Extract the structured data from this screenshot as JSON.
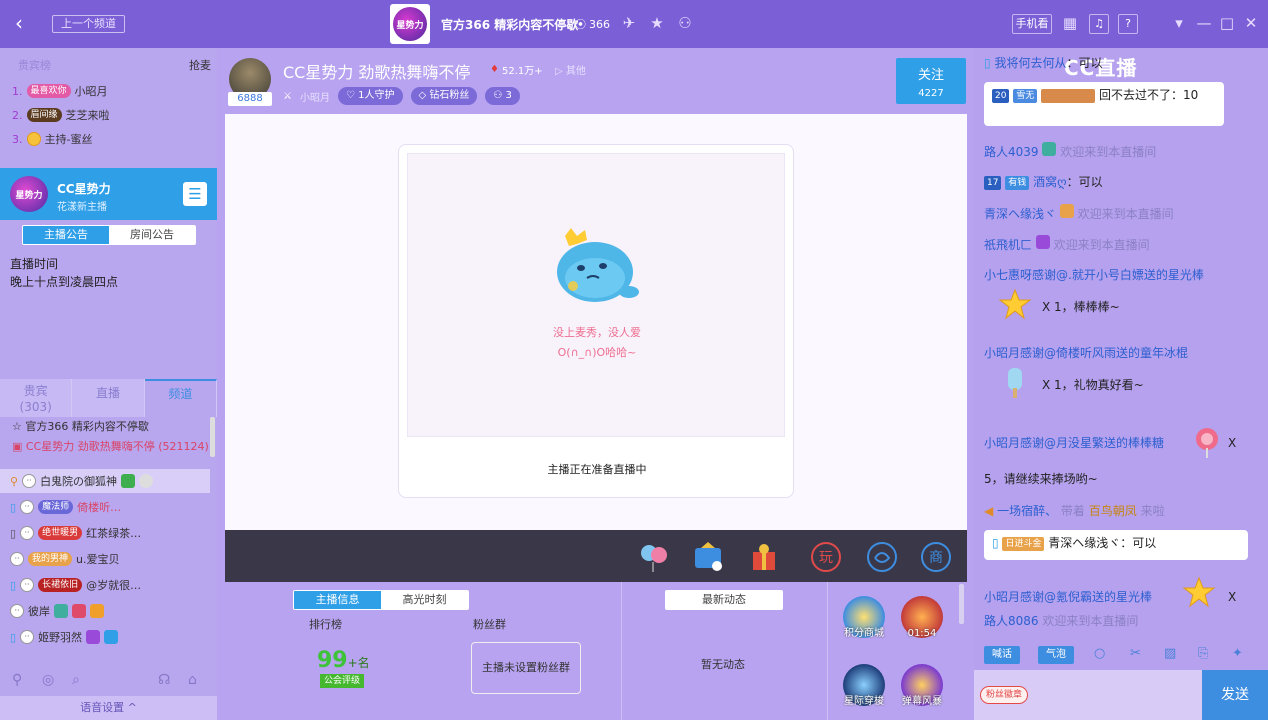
{
  "titlebar": {
    "prev_channel": "上一个频道",
    "channel_title": "官方366 精彩内容不停歇",
    "online_count": "366",
    "phone_watch": "手机看",
    "logo_text": "星势力"
  },
  "left": {
    "rank_header_left": "贵宾榜",
    "rank_header_right": "抢麦",
    "rank": [
      {
        "num": "1.",
        "medal": "最喜欢你",
        "name": "小昭月"
      },
      {
        "num": "2.",
        "medal": "眉间缘",
        "name": "芝芝来啦"
      },
      {
        "num": "3.",
        "medal": "",
        "name": "主持-蜜丝"
      }
    ],
    "anchor": {
      "name": "CC星势力",
      "subtitle": "花漾新主播",
      "avatar_text": "星势力"
    },
    "announce_tabs": [
      "主播公告",
      "房间公告"
    ],
    "announce_text": [
      "直播时间",
      "晚上十点到凌晨四点"
    ],
    "audience_tabs": [
      {
        "label": "贵宾",
        "count": "(303)"
      },
      {
        "label": "直播"
      },
      {
        "label": "频道"
      }
    ],
    "channels": [
      {
        "label": "官方366  精彩内容不停歇"
      },
      {
        "label": "CC星势力  劲歌热舞嗨不停",
        "extra": "(521124)"
      }
    ],
    "audience": [
      {
        "name": "白鬼院の御狐神"
      },
      {
        "name": "魔法师",
        "extra": "倚楼听…"
      },
      {
        "name": "绝世暖男",
        "extra": "红茶绿茶…"
      },
      {
        "name": "我的男神",
        "extra": "u.爱宝贝"
      },
      {
        "name": "长裙依旧",
        "extra": "@岁就很…"
      },
      {
        "name": "彼岸"
      },
      {
        "name": "姬野羽然"
      }
    ],
    "voice_settings": "语音设置 ^"
  },
  "stream": {
    "title": "CC星势力 劲歌热舞嗨不停",
    "heat": "52.1万+",
    "other": "其他",
    "room_id": "6888",
    "host_name": "小昭月",
    "guard": "1人守护",
    "diamond_fans": "钻石粉丝",
    "viewers": "3",
    "follow_label": "关注",
    "follow_count": "4227",
    "placeholder_line1": "没上麦秀，没人爱",
    "placeholder_line2": "O(∩_∩)O哈哈~",
    "status": "主播正在准备直播中"
  },
  "bottom": {
    "tabs": [
      "主播信息",
      "高光时刻"
    ],
    "rank_label": "排行榜",
    "fans_label": "粉丝群",
    "rank_value": "99",
    "rank_suffix": "+名",
    "guild_label": "公会评级",
    "fans_box": "主播未设置粉丝群",
    "news_tab": "最新动态",
    "no_news": "暂无动态",
    "activities": [
      {
        "label": "积分商城"
      },
      {
        "label": "01:54"
      },
      {
        "label": "星际穿梭"
      },
      {
        "label": "弹幕风暴"
      }
    ]
  },
  "chat": {
    "brand": "CC直播",
    "messages": [
      {
        "user": "我将何去何从",
        "text": "：可以"
      },
      {
        "level": "20",
        "user": "雪无",
        "text": "回不去过不了：10"
      },
      {
        "user": "路人4039",
        "text": "欢迎来到本直播间"
      },
      {
        "level": "17",
        "badge": "有钱",
        "user": "酒窝ღ",
        "text": "：可以"
      },
      {
        "user": "青深ヘ缘浅ヾ",
        "text": "欢迎来到本直播间"
      },
      {
        "user": "祇飛机ㄈ",
        "text": "欢迎来到本直播间"
      },
      {
        "user": "小七惠呀",
        "text": "感谢@.就开小号白嫖送的星光棒"
      },
      {
        "count": "X 1，棒棒棒~"
      },
      {
        "user": "小昭月",
        "text": "感谢@倚楼听风雨送的童年冰棍"
      },
      {
        "count": "X 1，礼物真好看~"
      },
      {
        "user": "小昭月",
        "text": "感谢@月没星繁送的棒棒糖",
        "x": "X"
      },
      {
        "count": "5，请继续来捧场哟~"
      },
      {
        "user": "一场宿醉、",
        "pre": "带着",
        "gold": "百鸟朝凤",
        "text": "来啦"
      },
      {
        "badge": "日进斗金",
        "user": "青深ヘ缘浅ヾ",
        "text": "：可以"
      },
      {
        "user": "小昭月",
        "text": "感谢@氪倪霸送的星光棒",
        "x": "X"
      },
      {
        "user": "路人8086",
        "text": "欢迎来到本直播间"
      }
    ],
    "tools": [
      "喊话",
      "气泡"
    ],
    "fan_seal": "粉丝徽章",
    "send": "发送"
  }
}
